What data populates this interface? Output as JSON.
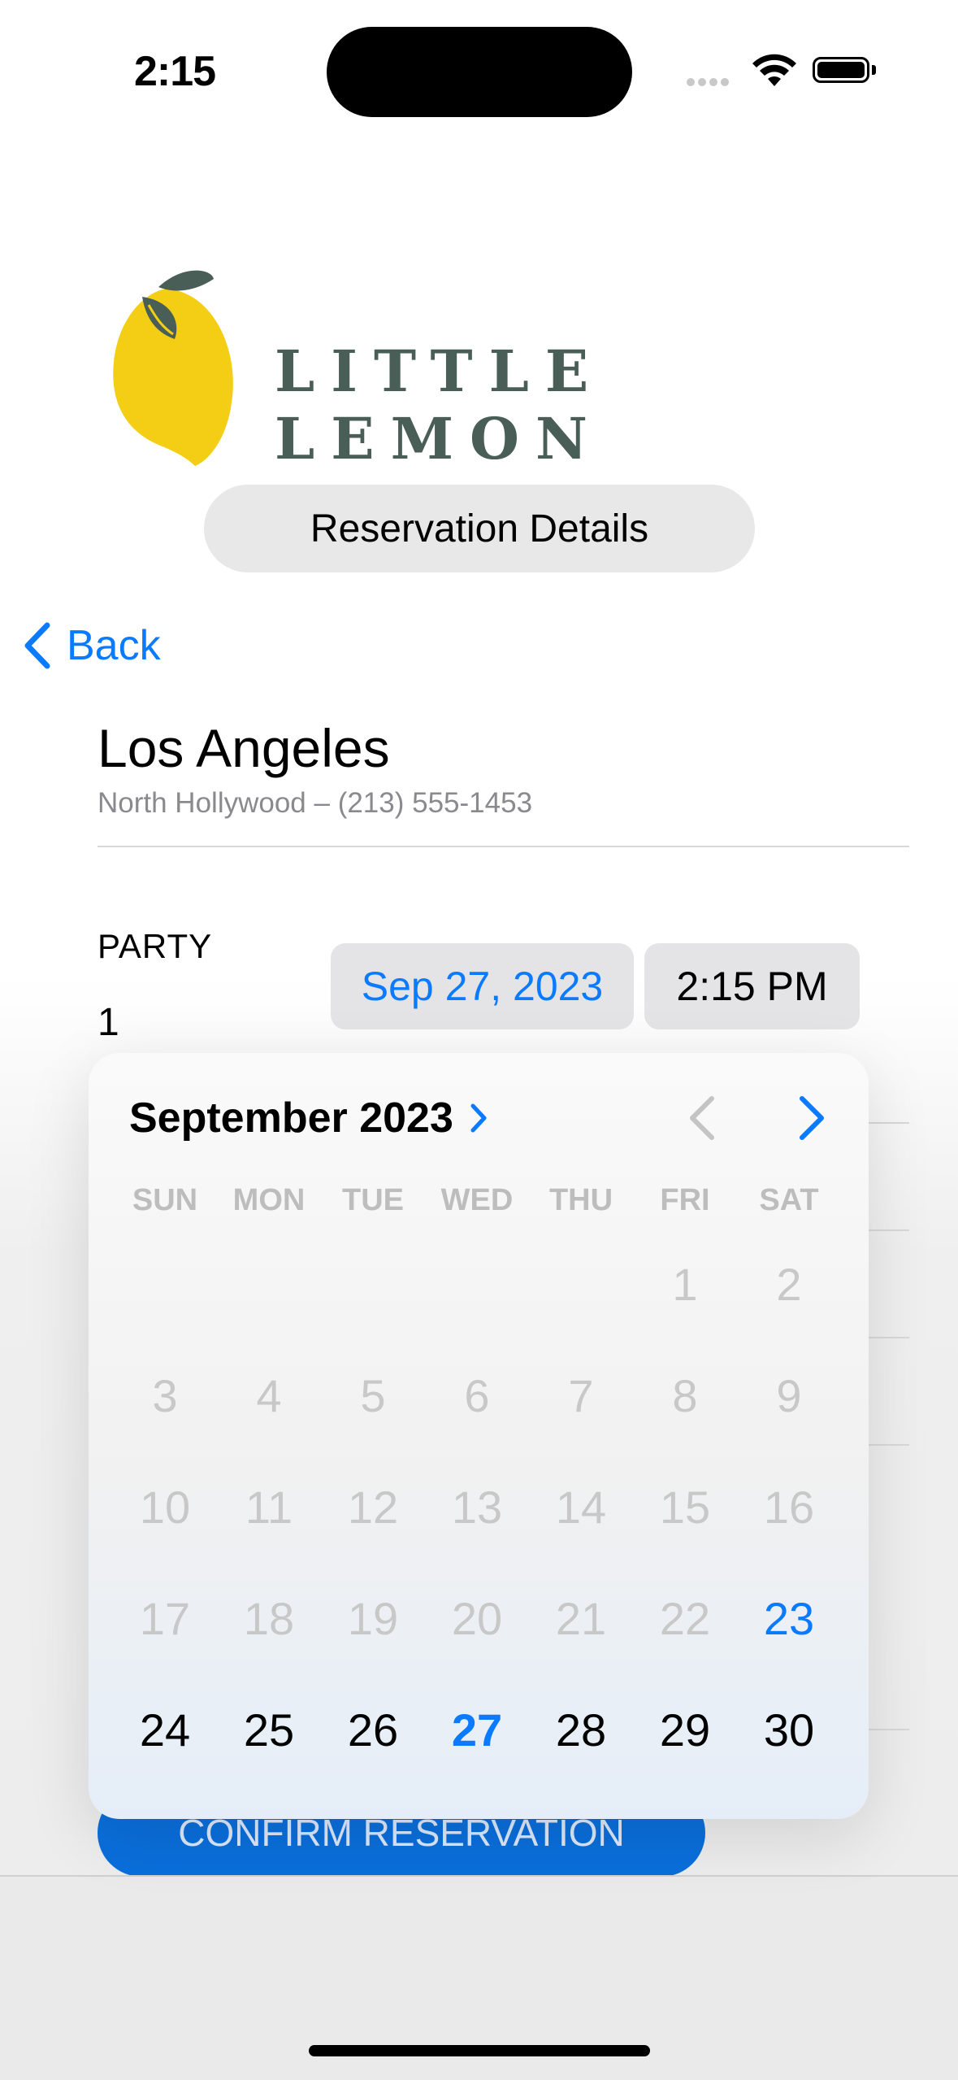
{
  "status_bar": {
    "time": "2:15"
  },
  "brand": {
    "name": "LITTLE LEMON"
  },
  "header": {
    "title": "Reservation Details"
  },
  "nav": {
    "back_label": "Back"
  },
  "location": {
    "city": "Los Angeles",
    "subtitle": "North Hollywood  –  (213) 555-1453"
  },
  "party": {
    "label": "PARTY",
    "value": "1"
  },
  "date_button": {
    "label": "Sep 27, 2023"
  },
  "time_button": {
    "label": "2:15 PM"
  },
  "calendar": {
    "month_label": "September 2023",
    "weekdays": [
      "SUN",
      "MON",
      "TUE",
      "WED",
      "THU",
      "FRI",
      "SAT"
    ],
    "weeks": [
      [
        "",
        "",
        "",
        "",
        "",
        "1",
        "2"
      ],
      [
        "3",
        "4",
        "5",
        "6",
        "7",
        "8",
        "9"
      ],
      [
        "10",
        "11",
        "12",
        "13",
        "14",
        "15",
        "16"
      ],
      [
        "17",
        "18",
        "19",
        "20",
        "21",
        "22",
        "23"
      ],
      [
        "24",
        "25",
        "26",
        "27",
        "28",
        "29",
        "30"
      ]
    ],
    "today": "23",
    "selected": "27",
    "first_enabled": "23"
  },
  "confirm_button": {
    "label": "CONFIRM RESERVATION"
  },
  "colors": {
    "accent": "#0a7aff",
    "brand": "#495e57",
    "lemon": "#f4ce14"
  }
}
